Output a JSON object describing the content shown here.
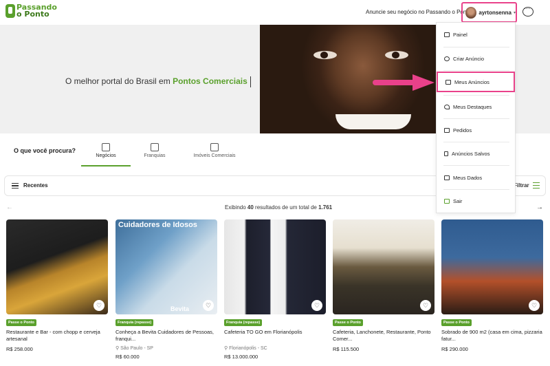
{
  "header": {
    "logo_line1": "Passando",
    "logo_line2": "o Ponto",
    "anuncie": "Anuncie seu negócio no Passando o Ponto",
    "username": "ayrtonsenna"
  },
  "hero": {
    "text_prefix": "O melhor portal do Brasil em ",
    "text_highlight": "Pontos Comerciais"
  },
  "search": {
    "label": "O que você procura?",
    "tabs": [
      {
        "label": "Negócios",
        "icon": "money-icon",
        "active": true
      },
      {
        "label": "Franquias",
        "icon": "network-icon",
        "active": false
      },
      {
        "label": "Imóveis Comerciais",
        "icon": "building-icon",
        "active": false
      }
    ]
  },
  "list_bar": {
    "recentes": "Recentes",
    "filtrar": "Filtrar"
  },
  "results": {
    "prefix": "Exibindo ",
    "shown": "40",
    "middle": " resultados de um total de ",
    "total": "1.761"
  },
  "cards": [
    {
      "badge": "Passe o Ponto",
      "title": "Restaurante e Bar - com chopp e cerveja artesanal",
      "location": "",
      "price": "R$ 258.000"
    },
    {
      "badge": "Franquia (repasse)",
      "title": "Conheça a Bevita Cuidadores de Pessoas, franqui...",
      "location": "São Paulo - SP",
      "price": "R$ 60.000",
      "image_text": "Cuidadores de Idosos",
      "image_brand": "Bevita"
    },
    {
      "badge": "Franquia (repasse)",
      "title": "Cafeteria TO GO em Florianópolis",
      "location": "Florianópolis - SC",
      "price": "R$ 13.000.000"
    },
    {
      "badge": "Passe o Ponto",
      "title": "Cafeteria, Lanchonete, Restaurante, Ponto Comer...",
      "location": "",
      "price": "R$ 115.500"
    },
    {
      "badge": "Passe o Ponto",
      "title": "Sobrado de 900 m2 (casa em cima, pizzaria fatur...",
      "location": "",
      "price": "R$ 290.000"
    }
  ],
  "menu": {
    "items": [
      {
        "label": "Painel",
        "icon": "monitor-icon"
      },
      {
        "label": "Criar Anúncio",
        "icon": "plus-circle-icon"
      },
      {
        "label": "Meus Anúncios",
        "icon": "list-icon"
      },
      {
        "label": "Meus Destaques",
        "icon": "rocket-icon"
      },
      {
        "label": "Pedidos",
        "icon": "monitor-icon"
      },
      {
        "label": "Anúncios Salvos",
        "icon": "bookmark-icon"
      },
      {
        "label": "Meus Dados",
        "icon": "id-card-icon"
      },
      {
        "label": "Sair",
        "icon": "lock-icon"
      }
    ],
    "highlighted_item": "Meus Anúncios"
  },
  "colors": {
    "brand_green": "#5aa02c",
    "highlight_pink": "#e9418a"
  }
}
